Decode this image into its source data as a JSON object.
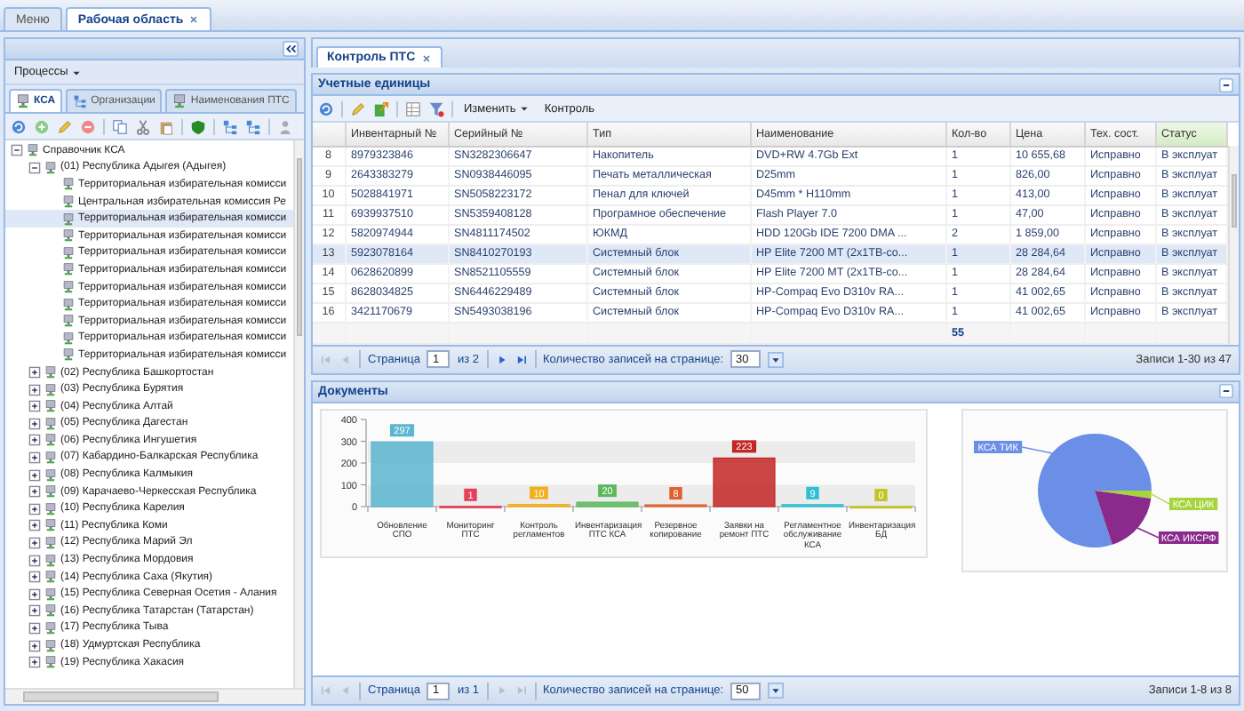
{
  "tabs": [
    {
      "label": "Меню",
      "selected": false,
      "closable": false
    },
    {
      "label": "Рабочая область",
      "selected": true,
      "closable": true
    }
  ],
  "left_panel": {
    "menu": "Процессы",
    "tabs": [
      {
        "label": "КСА",
        "selected": true
      },
      {
        "label": "Организации",
        "selected": false
      },
      {
        "label": "Наименования ПТС",
        "selected": false
      }
    ],
    "tree": {
      "label": "Справочник КСА",
      "expanded": true,
      "selected": false,
      "children": [
        {
          "label": "(01) Республика Адыгея (Адыгея)",
          "expanded": true,
          "selected": false,
          "children": [
            {
              "label": "Территориальная избирательная комисси",
              "selected": false
            },
            {
              "label": "Центральная избирательная комиссия Ре",
              "selected": false
            },
            {
              "label": "Территориальная избирательная комисси",
              "selected": true
            },
            {
              "label": "Территориальная избирательная комисси",
              "selected": false
            },
            {
              "label": "Территориальная избирательная комисси",
              "selected": false
            },
            {
              "label": "Территориальная избирательная комисси",
              "selected": false
            },
            {
              "label": "Территориальная избирательная комисси",
              "selected": false
            },
            {
              "label": "Территориальная избирательная комисси",
              "selected": false
            },
            {
              "label": "Территориальная избирательная комисси",
              "selected": false
            },
            {
              "label": "Территориальная избирательная комисси",
              "selected": false
            },
            {
              "label": "Территориальная избирательная комисси",
              "selected": false
            }
          ]
        },
        {
          "label": "(02) Республика Башкортостан",
          "expanded": false,
          "selected": false
        },
        {
          "label": "(03) Республика Бурятия",
          "expanded": false,
          "selected": false
        },
        {
          "label": "(04) Республика Алтай",
          "expanded": false,
          "selected": false
        },
        {
          "label": "(05) Республика Дагестан",
          "expanded": false,
          "selected": false
        },
        {
          "label": "(06) Республика Ингушетия",
          "expanded": false,
          "selected": false
        },
        {
          "label": "(07) Кабардино-Балкарская Республика",
          "expanded": false,
          "selected": false
        },
        {
          "label": "(08) Республика Калмыкия",
          "expanded": false,
          "selected": false
        },
        {
          "label": "(09) Карачаево-Черкесская Республика",
          "expanded": false,
          "selected": false
        },
        {
          "label": "(10) Республика Карелия",
          "expanded": false,
          "selected": false
        },
        {
          "label": "(11) Республика Коми",
          "expanded": false,
          "selected": false
        },
        {
          "label": "(12) Республика Марий Эл",
          "expanded": false,
          "selected": false
        },
        {
          "label": "(13) Республика Мордовия",
          "expanded": false,
          "selected": false
        },
        {
          "label": "(14) Республика Саха (Якутия)",
          "expanded": false,
          "selected": false
        },
        {
          "label": "(15) Республика Северная Осетия - Алания",
          "expanded": false,
          "selected": false
        },
        {
          "label": "(16) Республика Татарстан (Татарстан)",
          "expanded": false,
          "selected": false
        },
        {
          "label": "(17) Республика Тыва",
          "expanded": false,
          "selected": false
        },
        {
          "label": "(18) Удмуртская Республика",
          "expanded": false,
          "selected": false
        },
        {
          "label": "(19) Республика Хакасия",
          "expanded": false,
          "selected": false
        }
      ]
    }
  },
  "document_tab": {
    "label": "Контроль ПТС",
    "selected": true,
    "closable": true
  },
  "units": {
    "title": "Учетные единицы",
    "toolbar": {
      "menu": "Изменить",
      "button": "Контроль"
    },
    "columns": [
      {
        "label": "Инвентарный №",
        "highlighted": false
      },
      {
        "label": "Серийный №",
        "highlighted": false
      },
      {
        "label": "Тип",
        "highlighted": false
      },
      {
        "label": "Наименование",
        "highlighted": false
      },
      {
        "label": "Кол-во",
        "highlighted": false
      },
      {
        "label": "Цена",
        "highlighted": false
      },
      {
        "label": "Тех. сост.",
        "highlighted": false
      },
      {
        "label": "Статус",
        "highlighted": true
      }
    ],
    "rows": [
      {
        "number": "8",
        "selected": false,
        "cells": [
          "8979323846",
          "SN3282306647",
          "Накопитель",
          "DVD+RW 4.7Gb Ext",
          "1",
          "10 655,68",
          "Исправно",
          "В эксплуат"
        ]
      },
      {
        "number": "9",
        "selected": false,
        "cells": [
          "2643383279",
          "SN0938446095",
          "Печать металлическая",
          "D25mm",
          "1",
          "826,00",
          "Исправно",
          "В эксплуат"
        ]
      },
      {
        "number": "10",
        "selected": false,
        "cells": [
          "5028841971",
          "SN5058223172",
          "Пенал для ключей",
          "D45mm * H110mm",
          "1",
          "413,00",
          "Исправно",
          "В эксплуат"
        ]
      },
      {
        "number": "11",
        "selected": false,
        "cells": [
          "6939937510",
          "SN5359408128",
          "Програмное обеспечение",
          "Flash Player 7.0",
          "1",
          "47,00",
          "Исправно",
          "В эксплуат"
        ]
      },
      {
        "number": "12",
        "selected": false,
        "cells": [
          "5820974944",
          "SN4811174502",
          "ЮКМД",
          "HDD 120Gb IDE 7200 DMA ...",
          "2",
          "1 859,00",
          "Исправно",
          "В эксплуат"
        ]
      },
      {
        "number": "13",
        "selected": true,
        "cells": [
          "5923078164",
          "SN8410270193",
          "Системный блок",
          "HP Elite 7200 MT (2x1TB-co...",
          "1",
          "28 284,64",
          "Исправно",
          "В эксплуат"
        ]
      },
      {
        "number": "14",
        "selected": false,
        "cells": [
          "0628620899",
          "SN8521105559",
          "Системный блок",
          "HP Elite 7200 MT (2x1TB-co...",
          "1",
          "28 284,64",
          "Исправно",
          "В эксплуат"
        ]
      },
      {
        "number": "15",
        "selected": false,
        "cells": [
          "8628034825",
          "SN6446229489",
          "Системный блок",
          "HP-Compaq Evo D310v RA...",
          "1",
          "41 002,65",
          "Исправно",
          "В эксплуат"
        ]
      },
      {
        "number": "16",
        "selected": false,
        "cells": [
          "3421170679",
          "SN5493038196",
          "Системный блок",
          "HP-Compaq Evo D310v RA...",
          "1",
          "41 002,65",
          "Исправно",
          "В эксплуат"
        ]
      }
    ],
    "total_quantity": "55",
    "pager": {
      "back_enabled": false,
      "forward_enabled": true,
      "page_label": "Страница",
      "page": "1",
      "page_count": "из 2",
      "page_size_label": "Количество записей на странице:",
      "page_size": "30",
      "summary": "Записи 1-30 из 47"
    }
  },
  "documents": {
    "title": "Документы",
    "chart_data": {
      "type": "bar",
      "categories": [
        "Обновление СПО",
        "Мониторинг ПТС",
        "Контроль регламентов",
        "Инвентаризация ПТС КСА",
        "Резервное копирование",
        "Заявки на ремонт ПТС",
        "Регламентное обслуживание КСА",
        "Инвентаризация БД"
      ],
      "values": [
        297,
        1,
        10,
        20,
        8,
        223,
        9,
        0
      ],
      "ylim": [
        0,
        400
      ],
      "yticks": [
        0,
        100,
        200,
        300,
        400
      ],
      "data_labels": true
    },
    "pie": {
      "slices": [
        {
          "label": "КСА ТИК",
          "color": "#6b8fe6"
        },
        {
          "label": "КСА ЦИК",
          "color": "#a6d43c"
        },
        {
          "label": "КСА ИКСРФ",
          "color": "#8a2a8c"
        }
      ]
    },
    "pager": {
      "back_enabled": false,
      "forward_enabled": false,
      "page_label": "Страница",
      "page": "1",
      "page_count": "из 1",
      "page_size_label": "Количество записей на странице:",
      "page_size": "50",
      "summary": "Записи 1-8 из 8"
    }
  }
}
